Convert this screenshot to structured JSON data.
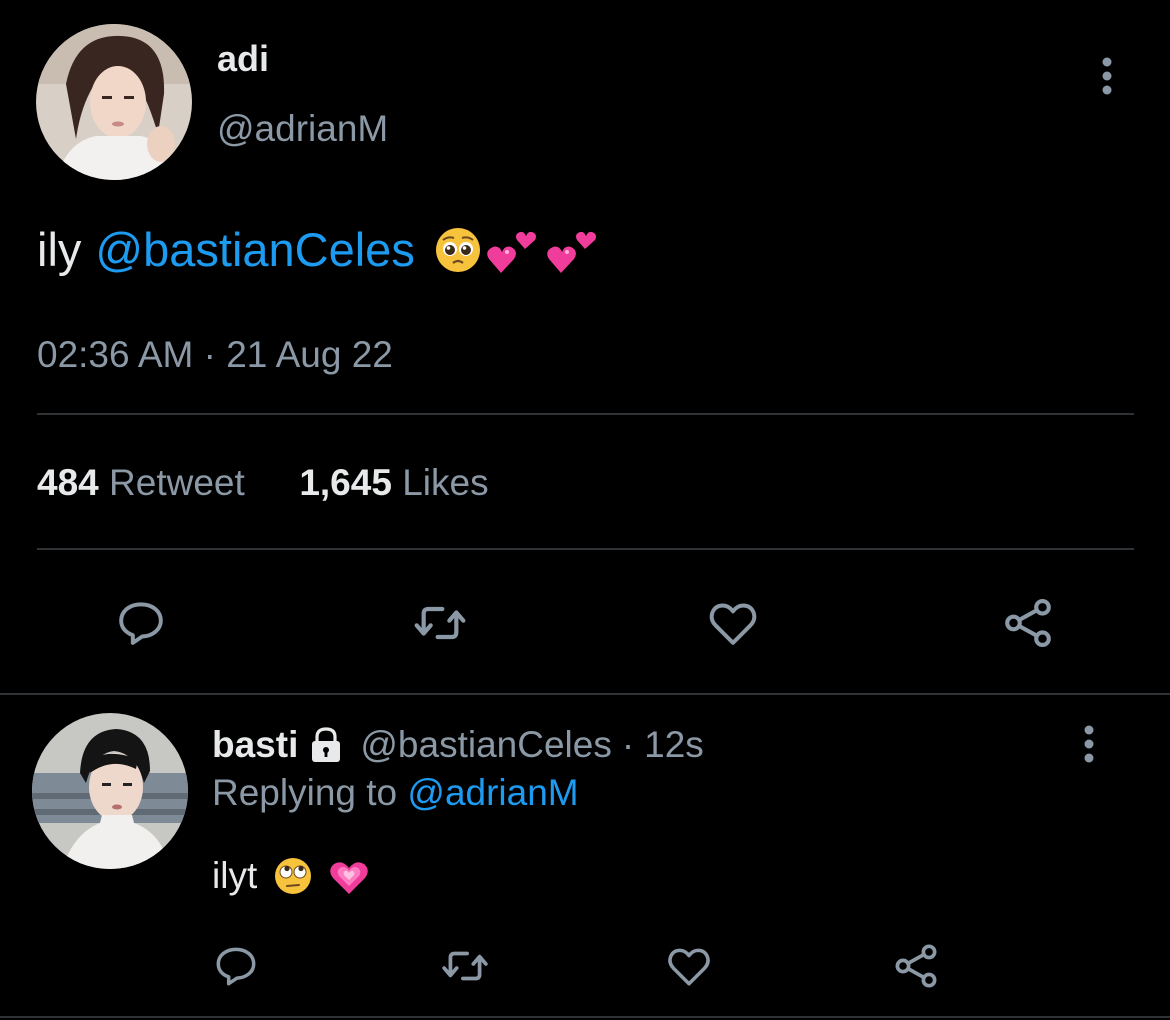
{
  "tweet": {
    "author_name": "adi",
    "author_handle": "@adrianM",
    "text_prefix": "ily",
    "mention": "@bastianCeles",
    "emojis": [
      "pleading-face",
      "two-hearts",
      "two-hearts"
    ],
    "timestamp": "02:36 AM · 21 Aug 22",
    "retweet_count": "484",
    "retweet_label": "Retweet",
    "like_count": "1,645",
    "like_label": "Likes",
    "actions": [
      "reply",
      "retweet",
      "like",
      "share"
    ]
  },
  "reply": {
    "author_name": "basti",
    "locked": true,
    "author_handle": "@bastianCeles",
    "separator": "·",
    "age": "12s",
    "replying_prefix": "Replying to",
    "replying_to": "@adrianM",
    "text": "ilyt",
    "emojis": [
      "face-with-rolling-eyes",
      "growing-heart"
    ],
    "actions": [
      "reply",
      "retweet",
      "like",
      "share"
    ]
  },
  "colors": {
    "background": "#000000",
    "primary_text": "#e7e9ea",
    "secondary_text": "#8b98a5",
    "link": "#1d9bf0",
    "divider": "#2f3336"
  }
}
